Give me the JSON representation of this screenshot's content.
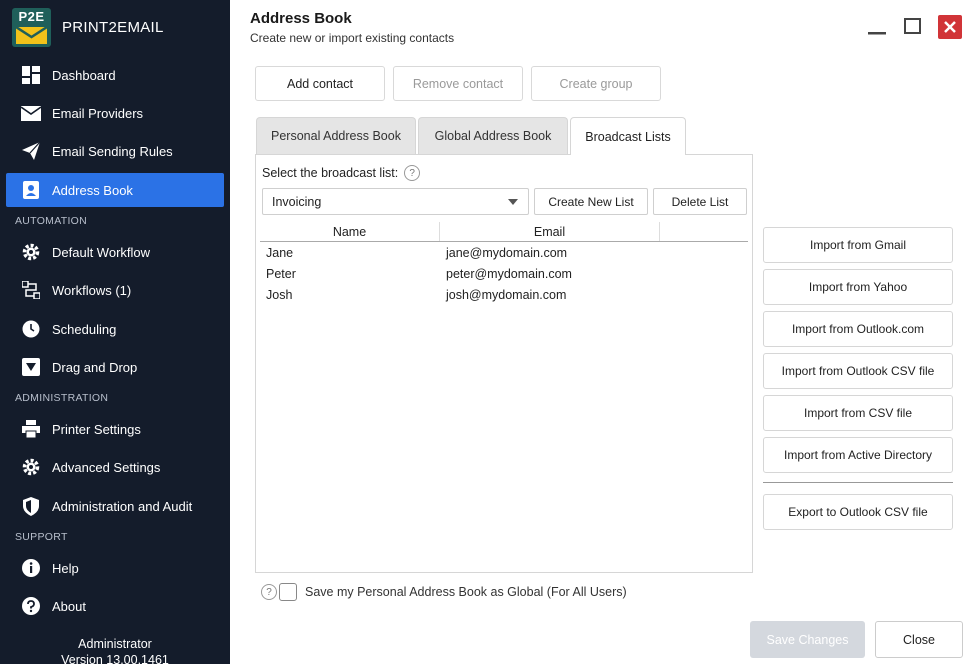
{
  "app": {
    "logo_text": "P2E",
    "brand": "PRINT2EMAIL"
  },
  "sidebar": {
    "items": [
      {
        "label": "Dashboard",
        "icon": "dashboard-icon"
      },
      {
        "label": "Email Providers",
        "icon": "envelope-icon"
      },
      {
        "label": "Email Sending Rules",
        "icon": "paper-plane-icon"
      },
      {
        "label": "Address Book",
        "icon": "contact-card-icon",
        "active": true
      },
      {
        "label": "Default Workflow",
        "icon": "gear-icon"
      },
      {
        "label": "Workflows (1)",
        "icon": "workflow-icon"
      },
      {
        "label": "Scheduling",
        "icon": "clock-icon"
      },
      {
        "label": "Drag and Drop",
        "icon": "drop-icon"
      },
      {
        "label": "Printer Settings",
        "icon": "printer-icon"
      },
      {
        "label": "Advanced Settings",
        "icon": "gear-icon"
      },
      {
        "label": "Administration and Audit",
        "icon": "shield-icon"
      },
      {
        "label": "Help",
        "icon": "info-icon"
      },
      {
        "label": "About",
        "icon": "question-icon"
      }
    ],
    "sections": [
      "AUTOMATION",
      "ADMINISTRATION",
      "SUPPORT"
    ],
    "user": {
      "name": "Administrator",
      "version": "Version 13.00.1461"
    }
  },
  "header": {
    "title": "Address Book",
    "subtitle": "Create new or import existing contacts"
  },
  "toolbar": {
    "add": "Add contact",
    "remove": "Remove contact",
    "group": "Create group"
  },
  "tabs": [
    "Personal Address Book",
    "Global Address Book",
    "Broadcast Lists"
  ],
  "broadcast": {
    "select_label": "Select the broadcast list:",
    "selected": "Invoicing",
    "create": "Create New List",
    "delete": "Delete List",
    "columns": [
      "Name",
      "Email"
    ],
    "rows": [
      {
        "name": "Jane",
        "email": "jane@mydomain.com"
      },
      {
        "name": "Peter",
        "email": "peter@mydomain.com"
      },
      {
        "name": "Josh",
        "email": "josh@mydomain.com"
      }
    ]
  },
  "imports": [
    "Import from Gmail",
    "Import from Yahoo",
    "Import from Outlook.com",
    "Import from Outlook CSV file",
    "Import from CSV file",
    "Import from Active Directory"
  ],
  "export": "Export to Outlook CSV file",
  "footer": {
    "save_global": "Save my Personal Address Book as Global (For All Users)",
    "save": "Save Changes",
    "close": "Close",
    "help_glyph": "?"
  },
  "colors": {
    "sidebar_bg": "#141c2b",
    "accent": "#2b72e6",
    "close_red": "#d13438",
    "logo_yellow": "#f2c21a"
  }
}
